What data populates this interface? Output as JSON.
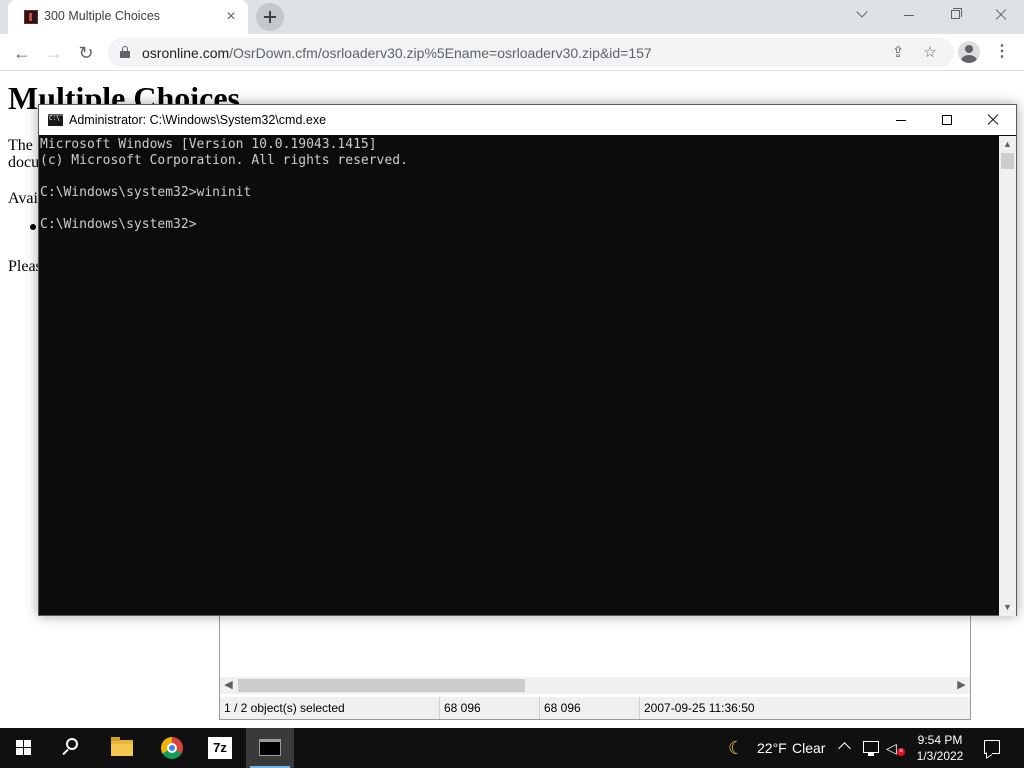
{
  "browser": {
    "tab_title": "300 Multiple Choices",
    "tab_close": "×",
    "url_host": "osronline.com",
    "url_path": "/OsrDown.cfm/osrloaderv30.zip%5Ename=osrloaderv30.zip&id=157",
    "icons": [
      "back-icon",
      "forward-icon",
      "reload-icon",
      "lock-icon",
      "share-icon",
      "star-icon",
      "profile-icon",
      "menu-icon"
    ]
  },
  "page": {
    "heading": "Multiple Choices",
    "line1a": "The",
    "line1b": "docu",
    "line2": "Avai",
    "line3": "Pleas"
  },
  "sevenzip": {
    "status": {
      "selected": "1 / 2 object(s) selected",
      "size": "68 096",
      "packed": "68 096",
      "modified": "2007-09-25 11:36:50"
    }
  },
  "cmd": {
    "title": "Administrator: C:\\Windows\\System32\\cmd.exe",
    "lines": [
      "Microsoft Windows [Version 10.0.19043.1415]",
      "(c) Microsoft Corporation. All rights reserved.",
      "",
      "C:\\Windows\\system32>wininit",
      "",
      "C:\\Windows\\system32>"
    ]
  },
  "taskbar": {
    "apps": [
      "start",
      "search",
      "file-explorer",
      "chrome",
      "7-zip",
      "command-prompt"
    ],
    "weather_temp": "22°F",
    "weather_desc": "Clear",
    "time": "9:54 PM",
    "date": "1/3/2022",
    "sevenzip_label": "7z"
  }
}
